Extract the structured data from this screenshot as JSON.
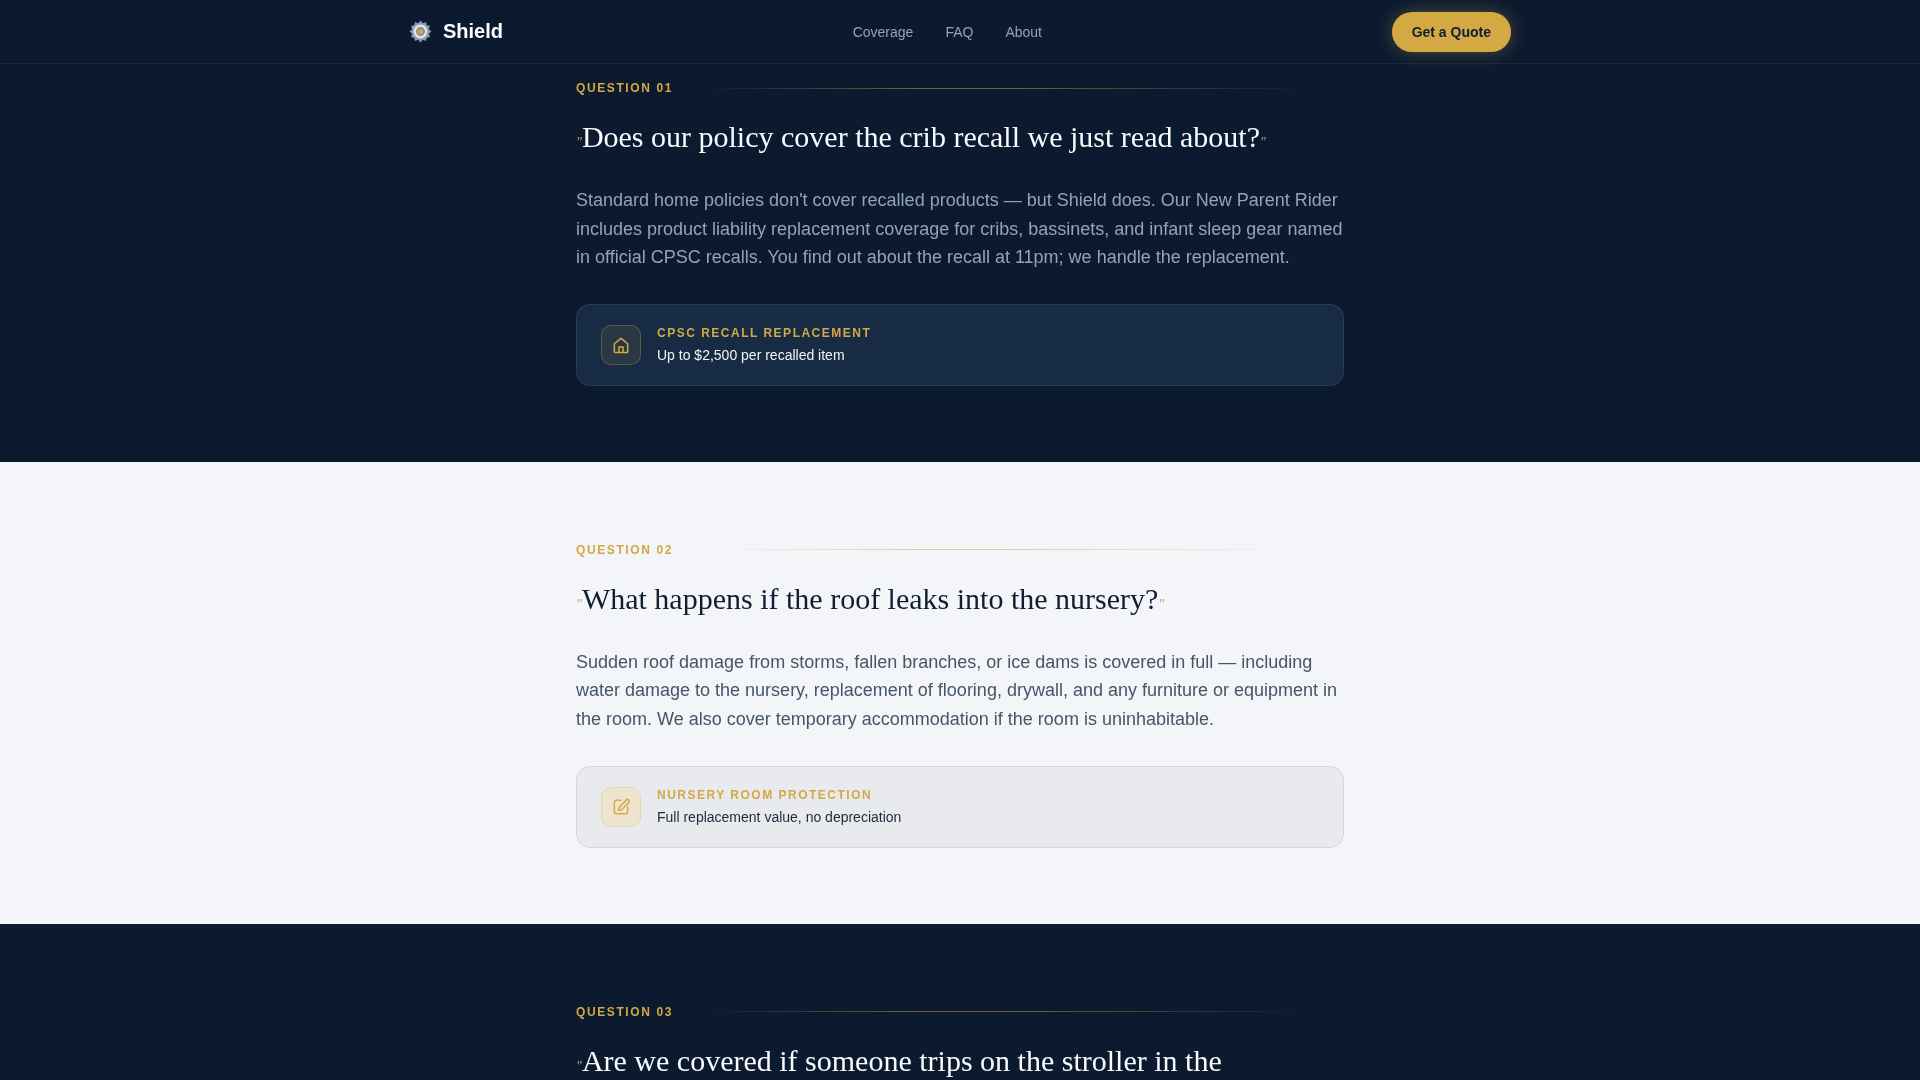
{
  "nav": {
    "brand": "Shield",
    "links": [
      "Coverage",
      "FAQ",
      "About"
    ],
    "cta": "Get a Quote"
  },
  "questions": [
    {
      "kind": "dark",
      "label": "QUESTION 01",
      "open_quote": "\"",
      "question": "Does our policy cover the crib recall we just read about?",
      "close_quote": "\"",
      "answer": "Standard home policies don't cover recalled products — but Shield does. Our New Parent Rider includes product liability replacement coverage for cribs, bassinets, and infant sleep gear named in official CPSC recalls. You find out about the recall at 11pm; we handle the replacement.",
      "card": {
        "title": "CPSC RECALL REPLACEMENT",
        "detail": "Up to $2,500 per recalled item"
      }
    },
    {
      "kind": "light",
      "label": "QUESTION 02",
      "open_quote": "\"",
      "question": "What happens if the roof leaks into the nursery?",
      "close_quote": "\"",
      "answer": "Sudden roof damage from storms, fallen branches, or ice dams is covered in full — including water damage to the nursery, replacement of flooring, drywall, and any furniture or equipment in the room. We also cover temporary accommodation if the room is uninhabitable.",
      "card": {
        "title": "NURSERY ROOM PROTECTION",
        "detail": "Full replacement value, no depreciation"
      }
    },
    {
      "kind": "dark",
      "label": "QUESTION 03",
      "open_quote": "\"",
      "question": "Are we covered if someone trips on the stroller in the"
    }
  ]
}
